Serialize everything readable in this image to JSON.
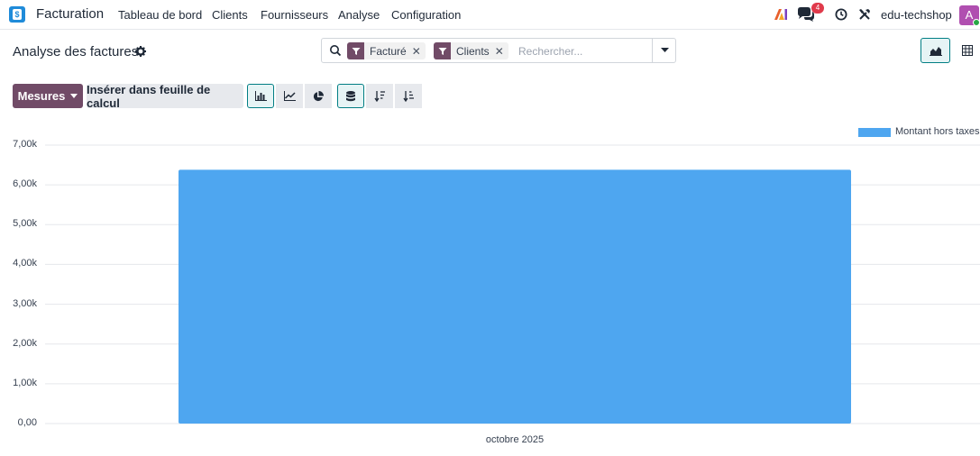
{
  "app": {
    "name": "Facturation",
    "menu": [
      "Tableau de bord",
      "Clients",
      "Fournisseurs",
      "Analyse",
      "Configuration"
    ],
    "company": "edu-techshop",
    "chat_badge": "4",
    "avatar_initial": "A"
  },
  "control_panel": {
    "title": "Analyse des factures",
    "facets": [
      "Facturé",
      "Clients"
    ],
    "search_placeholder": "Rechercher..."
  },
  "toolbar": {
    "measures_label": "Mesures",
    "insert_label": "Insérer dans feuille de calcul"
  },
  "chart_data": {
    "type": "bar",
    "categories": [
      "octobre 2025"
    ],
    "series": [
      {
        "name": "Montant hors taxes",
        "values": [
          6380
        ],
        "color": "#4ea6f0"
      }
    ],
    "ylim": [
      0,
      7000
    ],
    "yticks": [
      "0,00",
      "1,00k",
      "2,00k",
      "3,00k",
      "4,00k",
      "5,00k",
      "6,00k",
      "7,00k"
    ],
    "legend_position": "top-right",
    "grid": true
  }
}
